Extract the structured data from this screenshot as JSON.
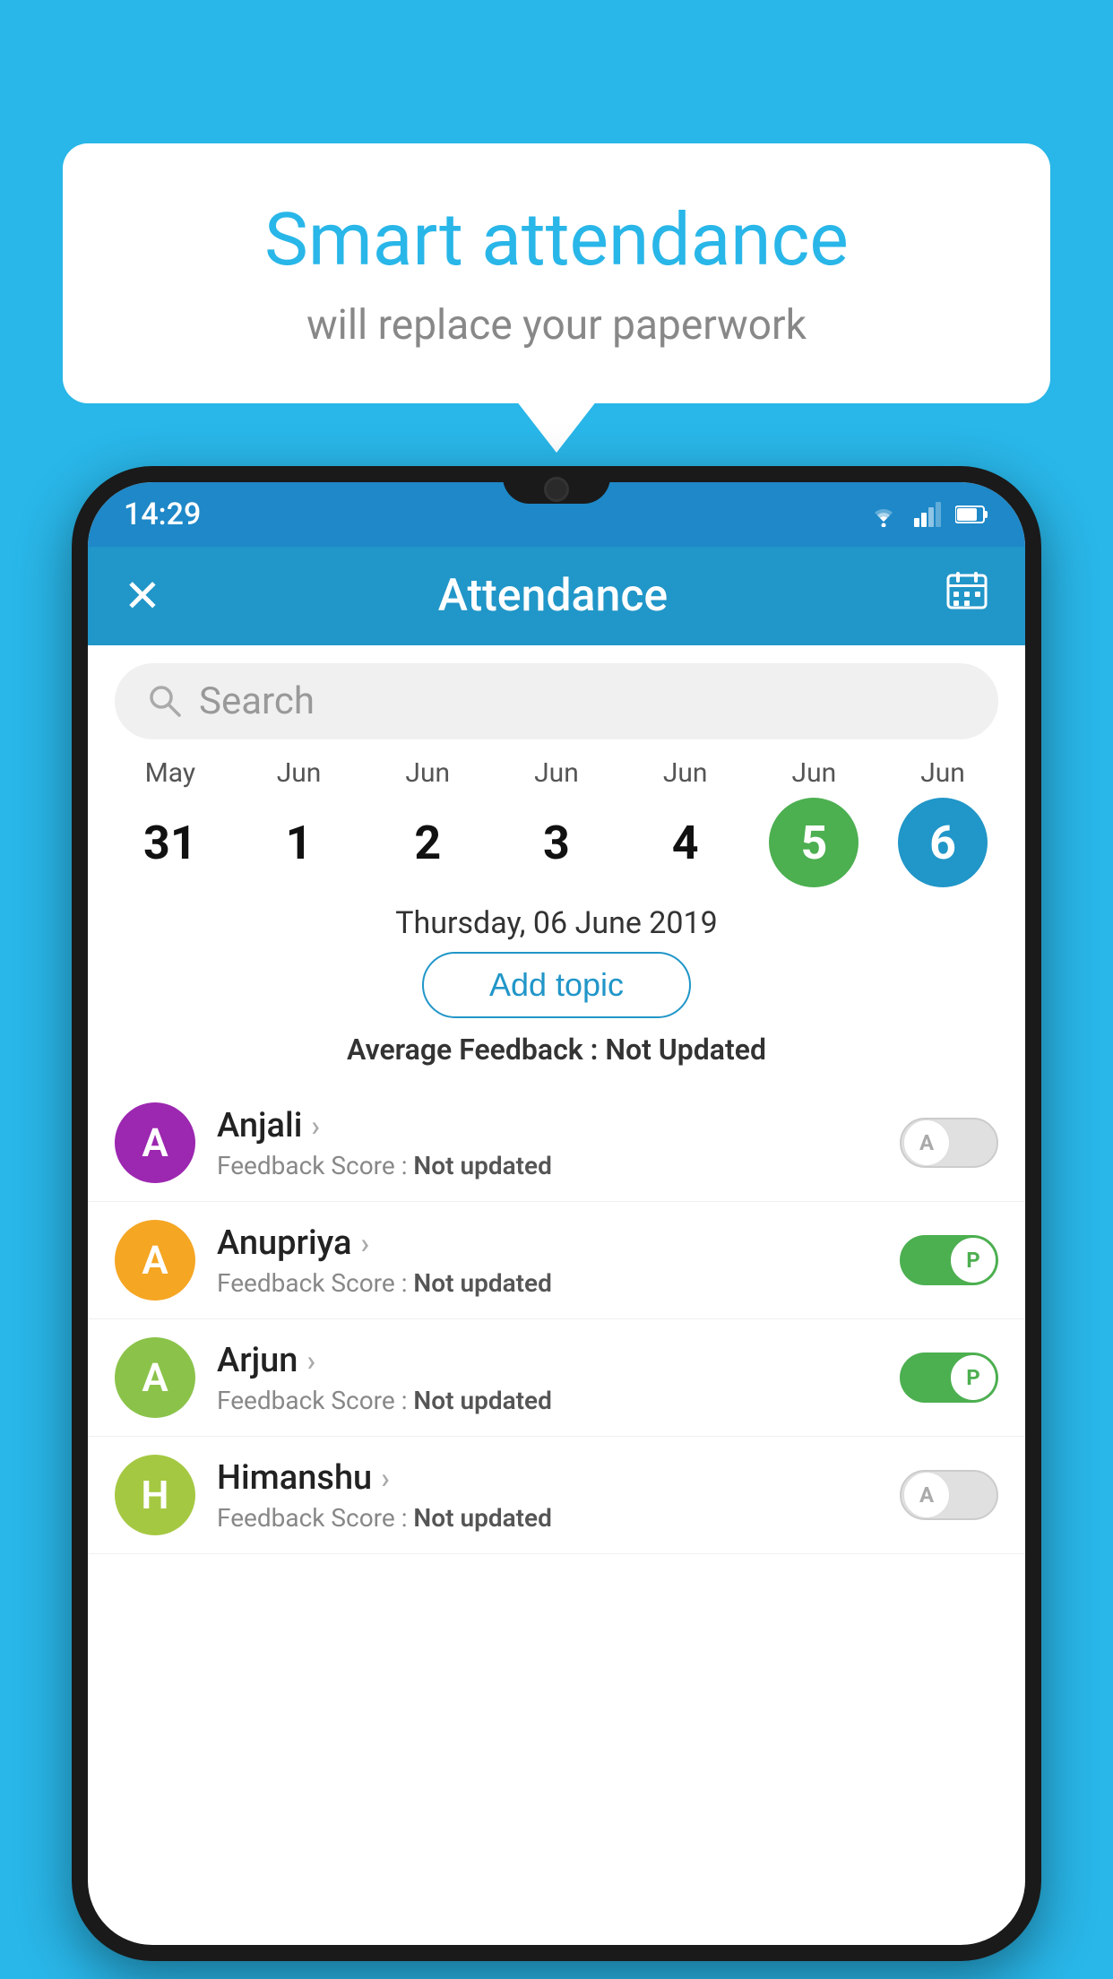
{
  "background_color": "#29b6e8",
  "speech_bubble": {
    "title": "Smart attendance",
    "subtitle": "will replace your paperwork"
  },
  "status_bar": {
    "time": "14:29"
  },
  "app_bar": {
    "title": "Attendance",
    "close_icon": "✕",
    "calendar_icon": "📅"
  },
  "search": {
    "placeholder": "Search"
  },
  "date_strip": [
    {
      "month": "May",
      "day": "31",
      "state": "normal"
    },
    {
      "month": "Jun",
      "day": "1",
      "state": "normal"
    },
    {
      "month": "Jun",
      "day": "2",
      "state": "normal"
    },
    {
      "month": "Jun",
      "day": "3",
      "state": "normal"
    },
    {
      "month": "Jun",
      "day": "4",
      "state": "normal"
    },
    {
      "month": "Jun",
      "day": "5",
      "state": "today"
    },
    {
      "month": "Jun",
      "day": "6",
      "state": "selected"
    }
  ],
  "selected_date_label": "Thursday, 06 June 2019",
  "add_topic_label": "Add topic",
  "avg_feedback_label": "Average Feedback : ",
  "avg_feedback_value": "Not Updated",
  "students": [
    {
      "name": "Anjali",
      "avatar_letter": "A",
      "avatar_color": "#9c27b0",
      "feedback_label": "Feedback Score : ",
      "feedback_value": "Not updated",
      "toggle": "off",
      "toggle_letter": "A"
    },
    {
      "name": "Anupriya",
      "avatar_letter": "A",
      "avatar_color": "#f5a623",
      "feedback_label": "Feedback Score : ",
      "feedback_value": "Not updated",
      "toggle": "on",
      "toggle_letter": "P"
    },
    {
      "name": "Arjun",
      "avatar_letter": "A",
      "avatar_color": "#8bc34a",
      "feedback_label": "Feedback Score : ",
      "feedback_value": "Not updated",
      "toggle": "on",
      "toggle_letter": "P"
    },
    {
      "name": "Himanshu",
      "avatar_letter": "H",
      "avatar_color": "#a5c842",
      "feedback_label": "Feedback Score : ",
      "feedback_value": "Not updated",
      "toggle": "off",
      "toggle_letter": "A"
    }
  ]
}
